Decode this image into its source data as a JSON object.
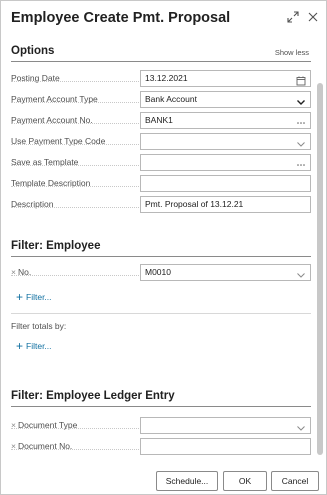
{
  "dialog": {
    "title": "Employee Create Pmt. Proposal"
  },
  "options": {
    "title": "Options",
    "show_less": "Show less",
    "fields": [
      {
        "label": "Posting Date",
        "value": "13.12.2021",
        "icon": "calendar-icon"
      },
      {
        "label": "Payment Account Type",
        "value": "Bank Account",
        "icon": "chevron-down-icon"
      },
      {
        "label": "Payment Account No.",
        "value": "BANK1",
        "icon": "ellipsis-icon"
      },
      {
        "label": "Use Payment Type Code",
        "value": "",
        "icon": "chevron-down-icon"
      },
      {
        "label": "Save as Template",
        "value": "",
        "icon": "ellipsis-icon"
      },
      {
        "label": "Template Description",
        "value": ""
      },
      {
        "label": "Description",
        "value": "Pmt. Proposal of 13.12.21"
      }
    ]
  },
  "filter_employee": {
    "title": "Filter: Employee",
    "field": {
      "label": "No.",
      "value": "M0010",
      "icon": "chevron-down-icon"
    },
    "add_filter": "Filter...",
    "totals_label": "Filter totals by:",
    "totals_add_filter": "Filter..."
  },
  "filter_ledger": {
    "title": "Filter: Employee Ledger Entry",
    "fields": [
      {
        "label": "Document Type",
        "value": "",
        "icon": "chevron-down-icon"
      },
      {
        "label": "Document No.",
        "value": ""
      }
    ]
  },
  "footer": {
    "schedule": "Schedule...",
    "ok": "OK",
    "cancel": "Cancel"
  }
}
